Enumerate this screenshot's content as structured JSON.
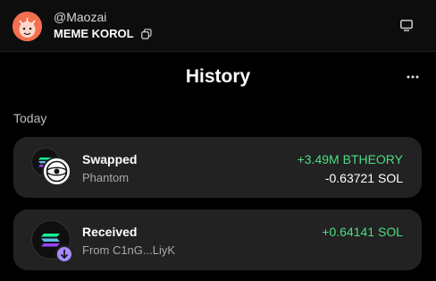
{
  "account": {
    "handle": "@Maozai",
    "name": "MEME KOROL"
  },
  "header": {
    "title": "History"
  },
  "section": {
    "label": "Today"
  },
  "transactions": [
    {
      "title": "Swapped",
      "subtitle": "Phantom",
      "amount_primary": "+3.49M BTHEORY",
      "amount_secondary": "-0.63721 SOL"
    },
    {
      "title": "Received",
      "subtitle": "From C1nG...LiyK",
      "amount_primary": "+0.64141 SOL",
      "amount_secondary": ""
    }
  ],
  "colors": {
    "accent_positive": "#4ade80",
    "avatar": "#f36f4f",
    "card_bg": "#222222"
  },
  "icons": {
    "avatar": "cartoon-avatar-icon",
    "copy": "copy-icon",
    "window": "window-icon",
    "more": "more-dots-icon",
    "swap_token_a": "solana-icon",
    "swap_token_b": "theory-token-icon",
    "receive_token": "solana-icon",
    "receive_badge": "arrow-down-icon"
  }
}
